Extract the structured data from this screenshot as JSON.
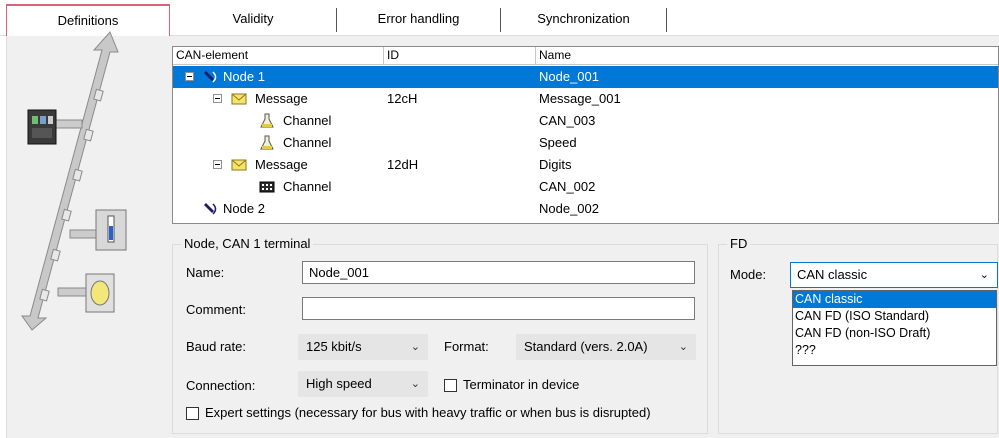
{
  "tabs": [
    {
      "label": "Definitions",
      "active": true
    },
    {
      "label": "Validity",
      "active": false
    },
    {
      "label": "Error handling",
      "active": false
    },
    {
      "label": "Synchronization",
      "active": false
    }
  ],
  "tree": {
    "columns": [
      "CAN-element",
      "ID",
      "Name"
    ],
    "rows": [
      {
        "type": "node",
        "label": "Node 1",
        "id": "",
        "name": "Node_001",
        "selected": true,
        "icon": "node-icon"
      },
      {
        "type": "message",
        "label": "Message",
        "id": "12cH",
        "name": "Message_001",
        "icon": "envelope-icon"
      },
      {
        "type": "channel",
        "label": "Channel",
        "id": "",
        "name": "CAN_003",
        "icon": "flask-icon"
      },
      {
        "type": "channel",
        "label": "Channel",
        "id": "",
        "name": "Speed",
        "icon": "flask-icon"
      },
      {
        "type": "message",
        "label": "Message",
        "id": "12dH",
        "name": "Digits",
        "icon": "envelope-icon"
      },
      {
        "type": "channel",
        "label": "Channel",
        "id": "",
        "name": "CAN_002",
        "icon": "display-icon"
      },
      {
        "type": "node",
        "label": "Node 2",
        "id": "",
        "name": "Node_002",
        "icon": "node-icon"
      }
    ]
  },
  "node_group": {
    "title": "Node, CAN 1 terminal",
    "name_label": "Name:",
    "name_value": "Node_001",
    "comment_label": "Comment:",
    "comment_value": "",
    "baud_label": "Baud rate:",
    "baud_value": "125 kbit/s",
    "format_label": "Format:",
    "format_value": "Standard (vers. 2.0A)",
    "connection_label": "Connection:",
    "connection_value": "High speed",
    "terminator_label": "Terminator in device",
    "expert_label": "Expert settings (necessary for bus with heavy traffic or when bus is disrupted)"
  },
  "fd_group": {
    "title": "FD",
    "mode_label": "Mode:",
    "mode_value": "CAN classic",
    "options": [
      "CAN classic",
      "CAN FD (ISO Standard)",
      "CAN FD (non-ISO Draft)",
      "???"
    ]
  },
  "colors": {
    "selection": "#0078d7",
    "active_tab_border": "#e0607a",
    "panel_bg": "#f0f0f0"
  }
}
